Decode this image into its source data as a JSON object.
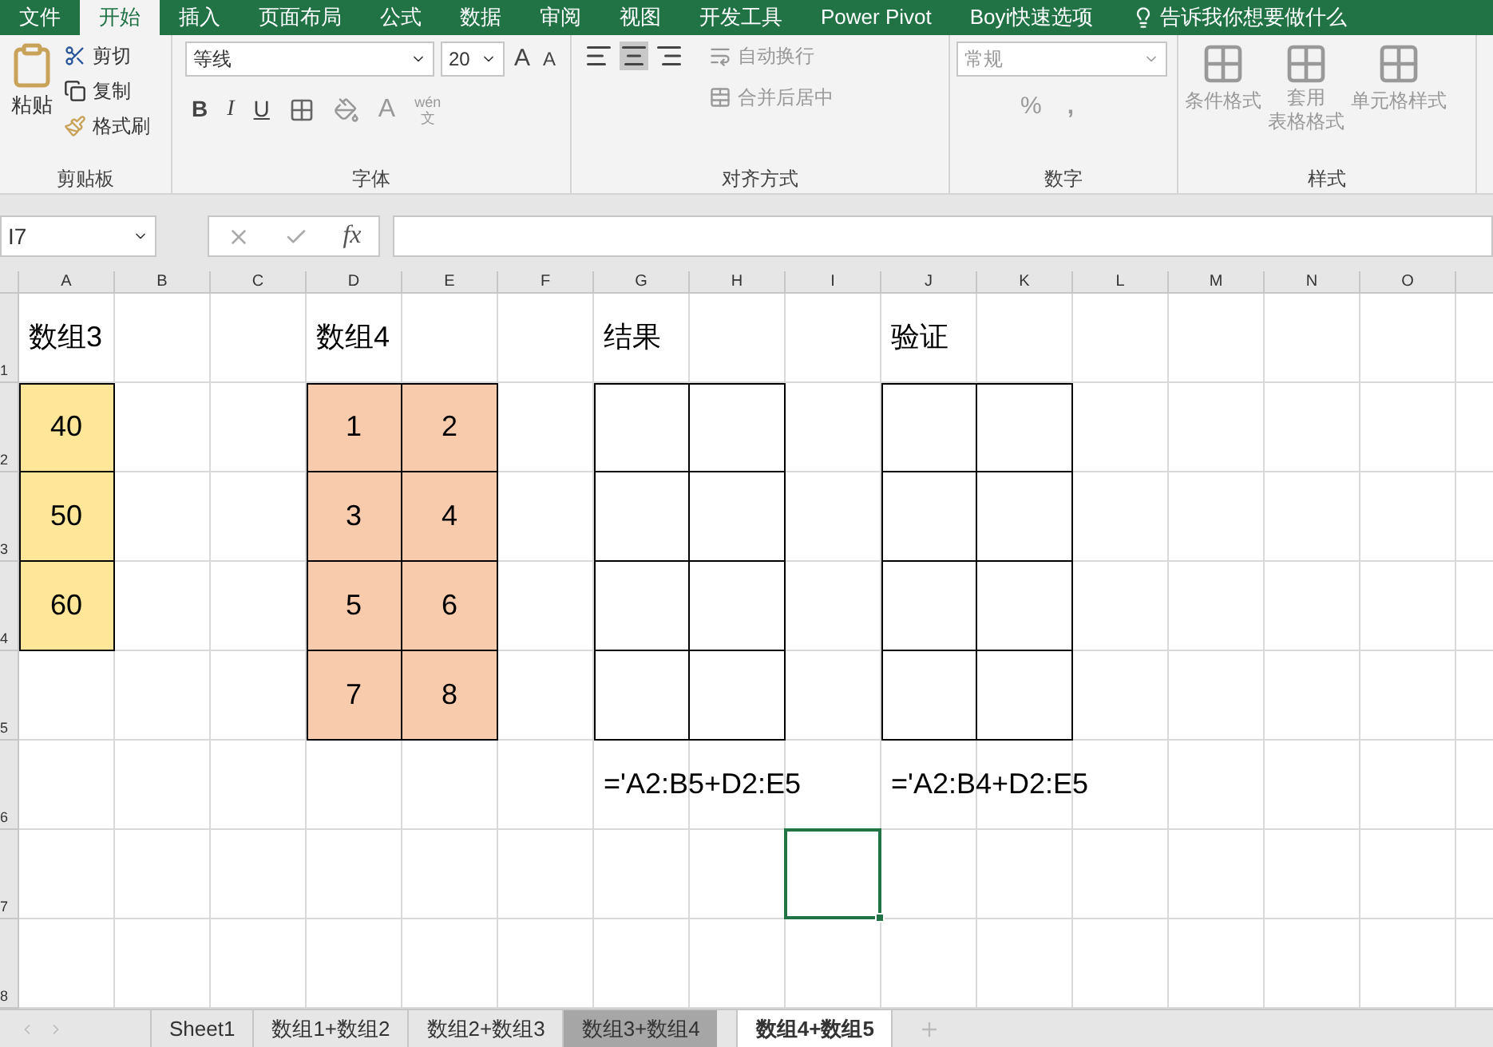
{
  "ribbon_tabs": [
    {
      "label": "文件",
      "selected": false
    },
    {
      "label": "开始",
      "selected": true
    },
    {
      "label": "插入",
      "selected": false
    },
    {
      "label": "页面布局",
      "selected": false
    },
    {
      "label": "公式",
      "selected": false
    },
    {
      "label": "数据",
      "selected": false
    },
    {
      "label": "审阅",
      "selected": false
    },
    {
      "label": "视图",
      "selected": false
    },
    {
      "label": "开发工具",
      "selected": false
    },
    {
      "label": "Power Pivot",
      "selected": false
    },
    {
      "label": "Boyi快速选项",
      "selected": false
    }
  ],
  "tell_me": "告诉我你想要做什么",
  "clipboard": {
    "paste": "粘贴",
    "cut": "剪切",
    "copy": "复制",
    "format_painter": "格式刷",
    "label": "剪贴板"
  },
  "font": {
    "name": "等线",
    "size": "20",
    "label": "字体",
    "grow": "A",
    "shrink": "A",
    "bold": "B",
    "italic": "I",
    "underline": "U",
    "font_color": "A",
    "phonetic_top": "wén",
    "phonetic_bottom": "文"
  },
  "alignment": {
    "wrap": "自动换行",
    "merge": "合并后居中",
    "label": "对齐方式"
  },
  "number": {
    "format": "常规",
    "percent": "%",
    "comma": ",",
    "label": "数字"
  },
  "styles": {
    "conditional": "条件格式",
    "table_line1": "套用",
    "table_line2": "表格格式",
    "cell_styles": "单元格样式",
    "label": "样式"
  },
  "formula_bar": {
    "name_box": "I7",
    "fx": "fx"
  },
  "columns": [
    "A",
    "B",
    "C",
    "D",
    "E",
    "F",
    "G",
    "H",
    "I",
    "J",
    "K",
    "L",
    "M",
    "N",
    "O"
  ],
  "rows": [
    {
      "number": "1",
      "cells": [
        {
          "text": "数组3"
        },
        {},
        {},
        {
          "text": "数组4"
        },
        {},
        {},
        {
          "text": "结果"
        },
        {},
        {},
        {
          "text": "验证"
        },
        {},
        {},
        {},
        {},
        {}
      ]
    },
    {
      "number": "2",
      "cells": [
        {
          "text": "40",
          "color": "#ffe699",
          "bordered": true
        },
        {},
        {},
        {
          "text": "1",
          "color": "#f8cbad",
          "bordered": true
        },
        {
          "text": "2",
          "color": "#f8cbad",
          "bordered": true
        },
        {},
        {
          "bordered": true
        },
        {
          "bordered": true
        },
        {},
        {
          "bordered": true
        },
        {
          "bordered": true
        },
        {},
        {},
        {},
        {}
      ]
    },
    {
      "number": "3",
      "cells": [
        {
          "text": "50",
          "color": "#ffe699",
          "bordered": true
        },
        {},
        {},
        {
          "text": "3",
          "color": "#f8cbad",
          "bordered": true
        },
        {
          "text": "4",
          "color": "#f8cbad",
          "bordered": true
        },
        {},
        {
          "bordered": true
        },
        {
          "bordered": true
        },
        {},
        {
          "bordered": true
        },
        {
          "bordered": true
        },
        {},
        {},
        {},
        {}
      ]
    },
    {
      "number": "4",
      "cells": [
        {
          "text": "60",
          "color": "#ffe699",
          "bordered": true
        },
        {},
        {},
        {
          "text": "5",
          "color": "#f8cbad",
          "bordered": true
        },
        {
          "text": "6",
          "color": "#f8cbad",
          "bordered": true
        },
        {},
        {
          "bordered": true
        },
        {
          "bordered": true
        },
        {},
        {
          "bordered": true
        },
        {
          "bordered": true
        },
        {},
        {},
        {},
        {}
      ]
    },
    {
      "number": "5",
      "cells": [
        {},
        {},
        {},
        {
          "text": "7",
          "color": "#f8cbad",
          "bordered": true
        },
        {
          "text": "8",
          "color": "#f8cbad",
          "bordered": true
        },
        {},
        {
          "bordered": true
        },
        {
          "bordered": true
        },
        {},
        {
          "bordered": true
        },
        {
          "bordered": true
        },
        {},
        {},
        {},
        {}
      ]
    },
    {
      "number": "6",
      "cells": [
        {},
        {},
        {},
        {},
        {},
        {},
        {
          "text": "='A2:B5+D2:E5"
        },
        {},
        {},
        {
          "text": "='A2:B4+D2:E5"
        },
        {},
        {},
        {},
        {},
        {}
      ]
    },
    {
      "number": "7",
      "cells": [
        {},
        {},
        {},
        {},
        {},
        {},
        {},
        {},
        {
          "selected": true
        },
        {},
        {},
        {},
        {},
        {},
        {}
      ]
    },
    {
      "number": "8",
      "cells": [
        {},
        {},
        {},
        {},
        {},
        {},
        {},
        {},
        {},
        {},
        {},
        {},
        {},
        {},
        {}
      ]
    }
  ],
  "sheet_tabs": [
    {
      "label": "Sheet1",
      "selected": false,
      "highlighted": false
    },
    {
      "label": "数组1+数组2",
      "selected": false,
      "highlighted": false
    },
    {
      "label": "数组2+数组3",
      "selected": false,
      "highlighted": false
    },
    {
      "label": "数组3+数组4",
      "selected": false,
      "highlighted": true
    },
    {
      "label": "数组4+数组5",
      "selected": true,
      "highlighted": false
    }
  ]
}
